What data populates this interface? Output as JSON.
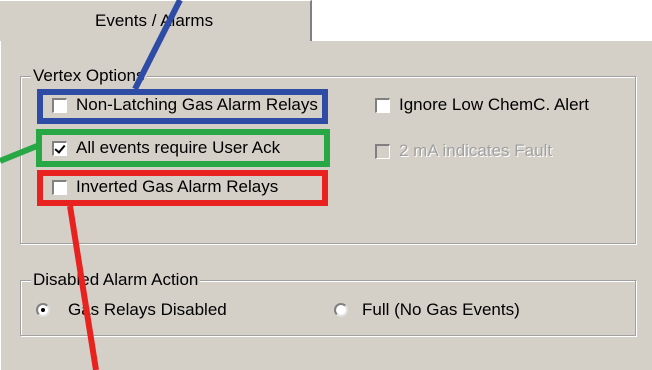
{
  "tabs": [
    {
      "label": "Events / Alarms"
    }
  ],
  "vertex_options": {
    "title": "Vertex Options",
    "options": [
      {
        "label": "Non-Latching Gas Alarm Relays",
        "checked": false,
        "enabled": true
      },
      {
        "label": "Ignore Low ChemC. Alert",
        "checked": false,
        "enabled": true
      },
      {
        "label": "All events require User Ack",
        "checked": true,
        "enabled": true
      },
      {
        "label": "2 mA indicates Fault",
        "checked": false,
        "enabled": false
      },
      {
        "label": "Inverted Gas Alarm Relays",
        "checked": false,
        "enabled": true
      }
    ]
  },
  "disabled_alarm_action": {
    "title": "Disabled Alarm Action",
    "options": [
      {
        "label": "Gas Relays Disabled",
        "selected": true
      },
      {
        "label": "Full (No Gas Events)",
        "selected": false
      }
    ]
  },
  "highlight_colors": {
    "blue": "#2e4ca6",
    "green": "#27a844",
    "red": "#e8231f"
  }
}
